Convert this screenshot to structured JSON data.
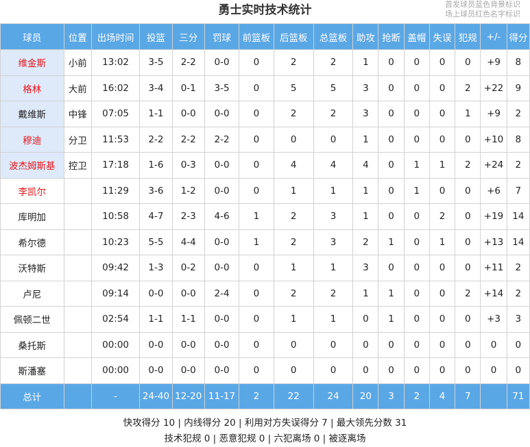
{
  "title": "勇士实时技术统计",
  "legend": [
    "首发球员蓝色背景标识",
    "场上球员红色名字标识"
  ],
  "columns": [
    "球员",
    "位置",
    "出场时间",
    "投篮",
    "三分",
    "罚球",
    "前篮板",
    "后篮板",
    "总篮板",
    "助攻",
    "抢断",
    "盖帽",
    "失误",
    "犯规",
    "+/-",
    "得分"
  ],
  "players": [
    {
      "name": "维金斯",
      "pos": "小前",
      "min": "13:02",
      "fg": "3-5",
      "tp": "2-2",
      "ft": "0-0",
      "oreb": "0",
      "dreb": "2",
      "reb": "2",
      "ast": "1",
      "stl": "0",
      "blk": "0",
      "tov": "0",
      "pf": "0",
      "pm": "+9",
      "pts": "8",
      "starter": true,
      "on_court": true
    },
    {
      "name": "格林",
      "pos": "大前",
      "min": "16:02",
      "fg": "3-4",
      "tp": "0-1",
      "ft": "3-5",
      "oreb": "0",
      "dreb": "5",
      "reb": "5",
      "ast": "3",
      "stl": "0",
      "blk": "0",
      "tov": "0",
      "pf": "2",
      "pm": "+22",
      "pts": "9",
      "starter": true,
      "on_court": true
    },
    {
      "name": "戴维斯",
      "pos": "中锋",
      "min": "07:05",
      "fg": "1-1",
      "tp": "0-0",
      "ft": "0-0",
      "oreb": "0",
      "dreb": "2",
      "reb": "2",
      "ast": "3",
      "stl": "0",
      "blk": "0",
      "tov": "0",
      "pf": "1",
      "pm": "+9",
      "pts": "2",
      "starter": true,
      "on_court": false
    },
    {
      "name": "穆迪",
      "pos": "分卫",
      "min": "11:53",
      "fg": "2-2",
      "tp": "2-2",
      "ft": "2-2",
      "oreb": "0",
      "dreb": "0",
      "reb": "0",
      "ast": "1",
      "stl": "0",
      "blk": "0",
      "tov": "0",
      "pf": "0",
      "pm": "+10",
      "pts": "8",
      "starter": true,
      "on_court": true
    },
    {
      "name": "波杰姆斯基",
      "pos": "控卫",
      "min": "17:18",
      "fg": "1-6",
      "tp": "0-3",
      "ft": "0-0",
      "oreb": "0",
      "dreb": "4",
      "reb": "4",
      "ast": "4",
      "stl": "0",
      "blk": "1",
      "tov": "1",
      "pf": "2",
      "pm": "+24",
      "pts": "2",
      "starter": true,
      "on_court": true
    },
    {
      "name": "李凯尔",
      "pos": "",
      "min": "11:29",
      "fg": "3-6",
      "tp": "1-2",
      "ft": "0-0",
      "oreb": "0",
      "dreb": "1",
      "reb": "1",
      "ast": "1",
      "stl": "0",
      "blk": "1",
      "tov": "0",
      "pf": "0",
      "pm": "+6",
      "pts": "7",
      "starter": false,
      "on_court": true
    },
    {
      "name": "库明加",
      "pos": "",
      "min": "10:58",
      "fg": "4-7",
      "tp": "2-3",
      "ft": "4-6",
      "oreb": "1",
      "dreb": "2",
      "reb": "3",
      "ast": "1",
      "stl": "0",
      "blk": "0",
      "tov": "2",
      "pf": "0",
      "pm": "+19",
      "pts": "14",
      "starter": false,
      "on_court": false
    },
    {
      "name": "希尔德",
      "pos": "",
      "min": "10:23",
      "fg": "5-5",
      "tp": "4-4",
      "ft": "0-0",
      "oreb": "1",
      "dreb": "2",
      "reb": "3",
      "ast": "2",
      "stl": "1",
      "blk": "0",
      "tov": "1",
      "pf": "0",
      "pm": "+13",
      "pts": "14",
      "starter": false,
      "on_court": false
    },
    {
      "name": "沃特斯",
      "pos": "",
      "min": "09:42",
      "fg": "1-3",
      "tp": "0-2",
      "ft": "0-0",
      "oreb": "0",
      "dreb": "1",
      "reb": "1",
      "ast": "3",
      "stl": "0",
      "blk": "0",
      "tov": "0",
      "pf": "0",
      "pm": "+11",
      "pts": "2",
      "starter": false,
      "on_court": false
    },
    {
      "name": "卢尼",
      "pos": "",
      "min": "09:14",
      "fg": "0-0",
      "tp": "0-0",
      "ft": "2-4",
      "oreb": "0",
      "dreb": "2",
      "reb": "2",
      "ast": "1",
      "stl": "1",
      "blk": "0",
      "tov": "0",
      "pf": "2",
      "pm": "+14",
      "pts": "2",
      "starter": false,
      "on_court": false
    },
    {
      "name": "佩顿二世",
      "pos": "",
      "min": "02:54",
      "fg": "1-1",
      "tp": "1-1",
      "ft": "0-0",
      "oreb": "0",
      "dreb": "1",
      "reb": "1",
      "ast": "0",
      "stl": "1",
      "blk": "0",
      "tov": "0",
      "pf": "0",
      "pm": "+3",
      "pts": "3",
      "starter": false,
      "on_court": false
    },
    {
      "name": "桑托斯",
      "pos": "",
      "min": "00:00",
      "fg": "0-0",
      "tp": "0-0",
      "ft": "0-0",
      "oreb": "0",
      "dreb": "0",
      "reb": "0",
      "ast": "0",
      "stl": "0",
      "blk": "0",
      "tov": "0",
      "pf": "0",
      "pm": "0",
      "pts": "0",
      "starter": false,
      "on_court": false
    },
    {
      "name": "斯潘塞",
      "pos": "",
      "min": "00:00",
      "fg": "0-0",
      "tp": "0-0",
      "ft": "0-0",
      "oreb": "0",
      "dreb": "0",
      "reb": "0",
      "ast": "0",
      "stl": "0",
      "blk": "0",
      "tov": "0",
      "pf": "0",
      "pm": "0",
      "pts": "0",
      "starter": false,
      "on_court": false
    }
  ],
  "totals": {
    "name": "总计",
    "pos": "",
    "min": "-",
    "fg": "24-40",
    "tp": "12-20",
    "ft": "11-17",
    "oreb": "2",
    "dreb": "22",
    "reb": "24",
    "ast": "20",
    "stl": "3",
    "blk": "2",
    "tov": "4",
    "pf": "7",
    "pm": "",
    "pts": "71"
  },
  "footer": {
    "line1": "快攻得分 10 | 内线得分 20 | 利用对方失误得分 7 | 最大领先分数 31",
    "line2": "技术犯规 0 | 恶意犯规 0 | 六犯离场 0 | 被逐离场"
  },
  "colors": {
    "header_bg": "#5aa7e6",
    "starter_bg": "#deeafa",
    "on_court_text": "#e5161b"
  }
}
